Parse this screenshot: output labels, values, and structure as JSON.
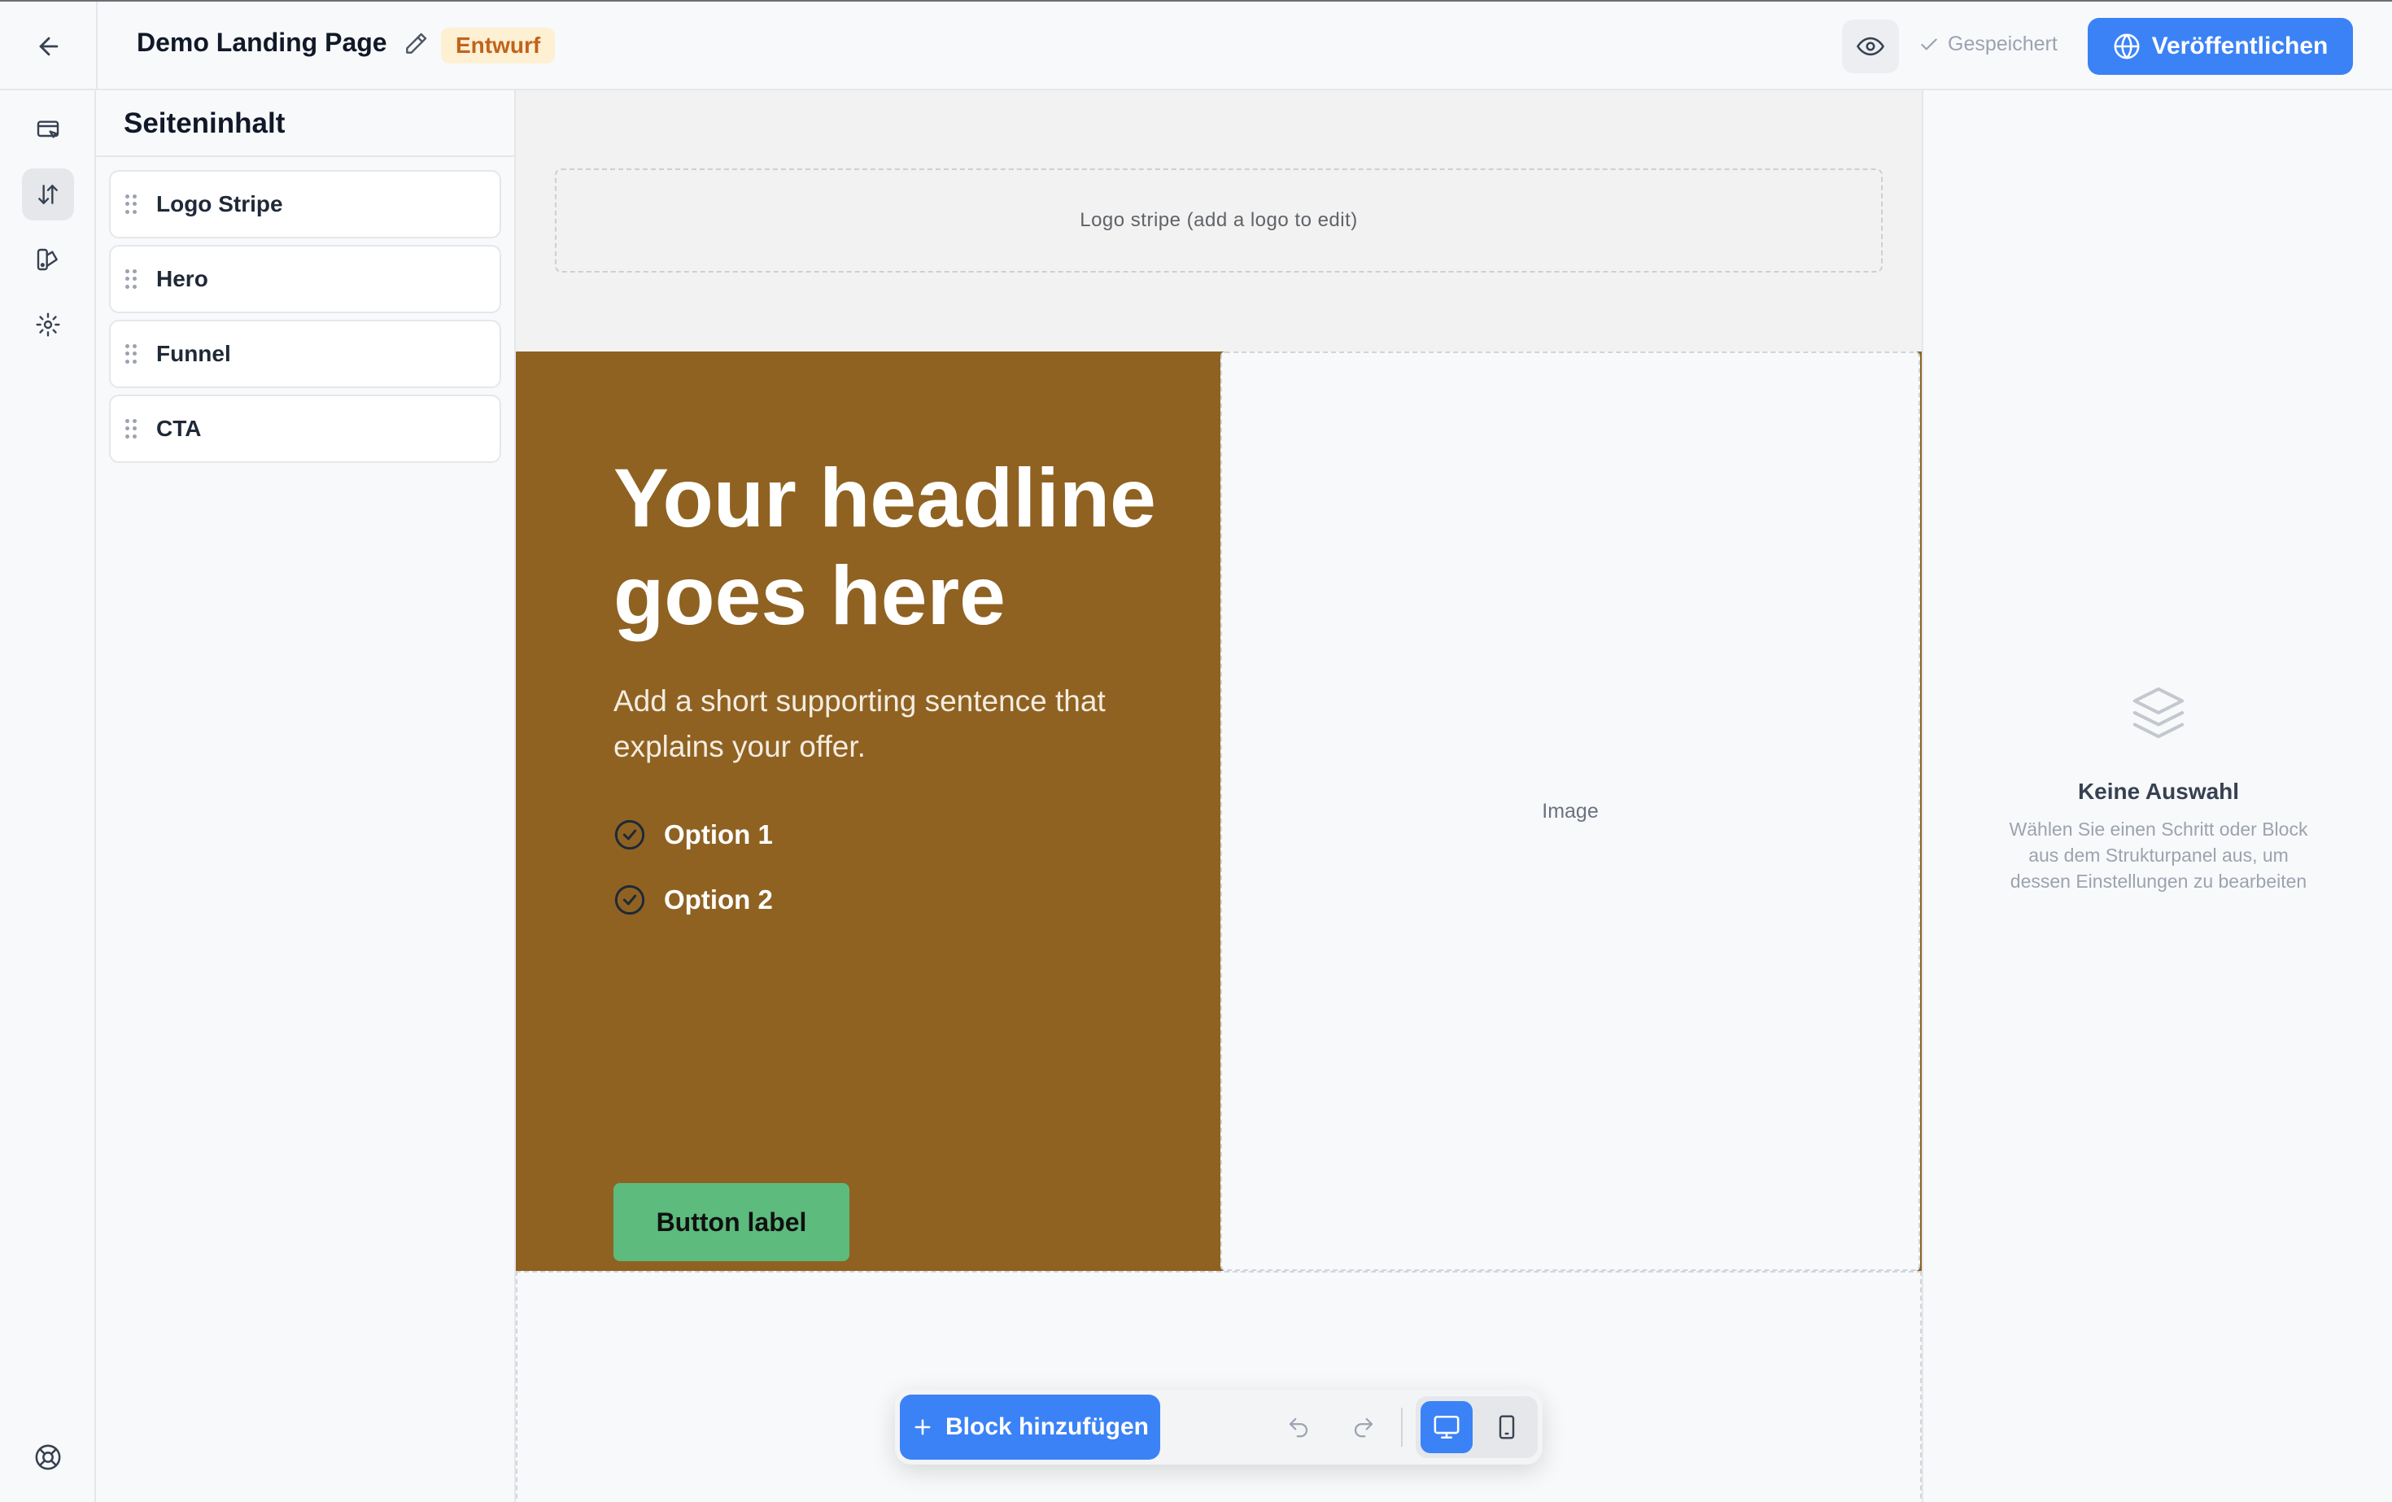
{
  "header": {
    "page_title": "Demo Landing Page",
    "status_badge": "Entwurf",
    "saved_status": "Gespeichert",
    "publish_label": "Veröffentlichen"
  },
  "rail": {
    "items": [
      {
        "icon": "page-settings-icon"
      },
      {
        "icon": "sort-arrows-icon",
        "active": true
      },
      {
        "icon": "palette-icon"
      },
      {
        "icon": "gear-icon"
      }
    ],
    "bottom_icon": "help-lifebuoy-icon"
  },
  "structure_panel": {
    "title": "Seiteninhalt",
    "blocks": [
      {
        "label": "Logo Stripe"
      },
      {
        "label": "Hero"
      },
      {
        "label": "Funnel"
      },
      {
        "label": "CTA"
      }
    ]
  },
  "canvas": {
    "logo_stripe_placeholder": "Logo stripe (add a logo to edit)",
    "hero": {
      "headline": "Your headline goes here",
      "subtext": "Add a short supporting sentence that explains your offer.",
      "options": [
        "Option 1",
        "Option 2"
      ],
      "button_label": "Button label",
      "image_placeholder": "Image",
      "background_color": "#8f6222",
      "button_color": "#5cbb7d"
    }
  },
  "toolbar": {
    "add_block_label": "Block hinzufügen",
    "active_device": "desktop"
  },
  "properties_panel": {
    "empty_title": "Keine Auswahl",
    "empty_description": "Wählen Sie einen Schritt oder Block aus dem Strukturpanel aus, um dessen Einstellungen zu bearbeiten"
  },
  "colors": {
    "accent": "#3b82f6",
    "draft_badge_bg": "#fdf0d3",
    "draft_badge_text": "#c2631c"
  }
}
